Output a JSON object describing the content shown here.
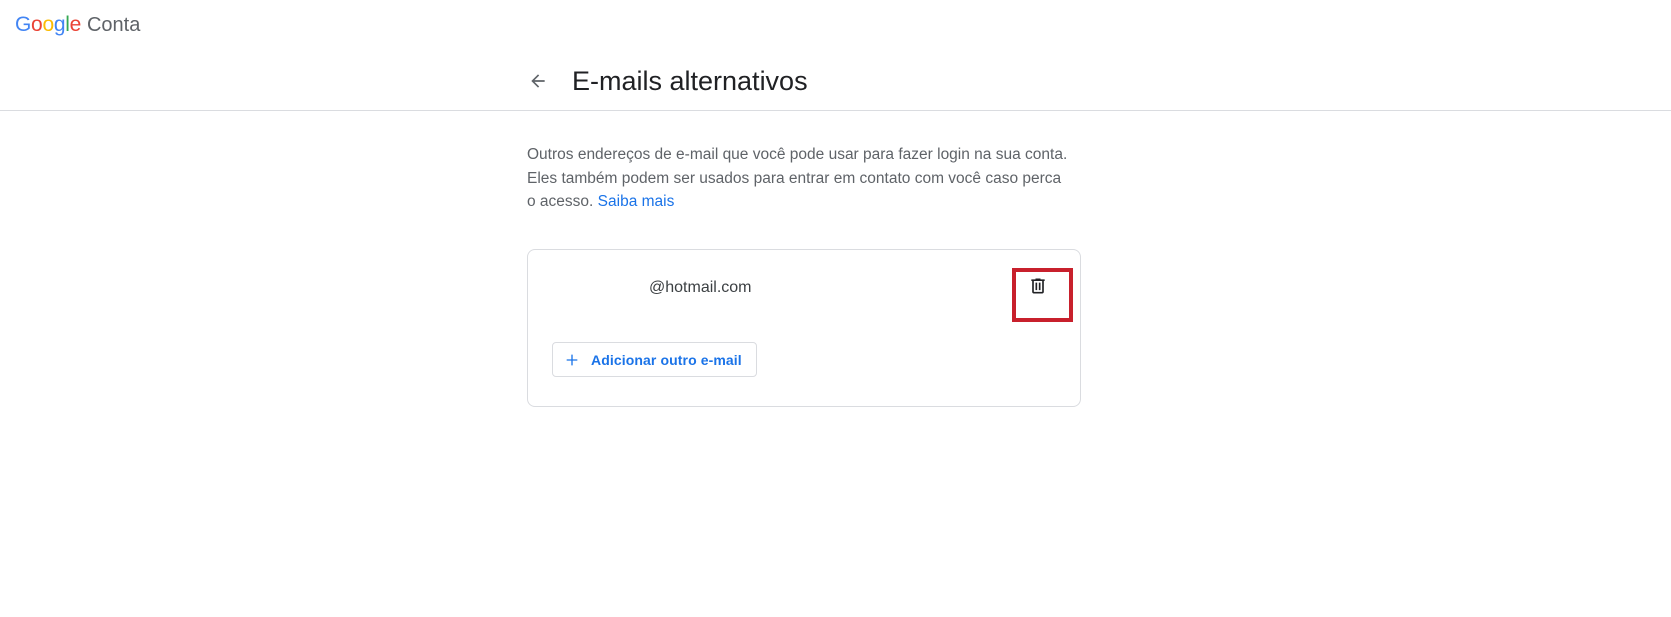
{
  "app": {
    "logo_letters": [
      "G",
      "o",
      "o",
      "g",
      "l",
      "e"
    ],
    "logo_colors": [
      "#4285F4",
      "#EA4335",
      "#FBBC05",
      "#4285F4",
      "#34A853",
      "#EA4335"
    ],
    "product_name": "Conta"
  },
  "page": {
    "title": "E-mails alternativos",
    "back_icon": "arrow-back-icon",
    "description": "Outros endereços de e-mail que você pode usar para fazer login na sua conta. Eles também podem ser usados para entrar em contato com você caso perca o acesso.",
    "learn_more_link": "Saiba mais"
  },
  "emails": [
    {
      "address": "@hotmail.com",
      "action_icon": "trash-icon"
    }
  ],
  "actions": {
    "add_label": "Adicionar outro e-mail",
    "add_icon": "plus-icon"
  },
  "colors": {
    "accent": "#1a73e8",
    "highlight": "#c8202c",
    "border": "#dadce0"
  }
}
